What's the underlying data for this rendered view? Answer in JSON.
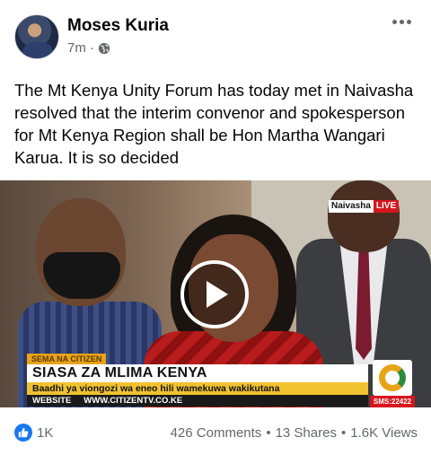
{
  "post": {
    "author": "Moses Kuria",
    "time": "7m",
    "separator": "·",
    "text": "The Mt Kenya Unity Forum has today met in Naivasha resolved that the interim convenor and spokesperson for Mt Kenya Region shall be Hon Martha Wangari Karua. It is so decided"
  },
  "video": {
    "live_place": "Naivasha",
    "live_word": "LIVE",
    "segment": "SEMA NA CITIZEN",
    "headline": "SIASA ZA MLIMA KENYA",
    "subline": "Baadhi ya viongozi wa eneo hili wamekuwa wakikutana",
    "web_label": "WEBSITE",
    "web_url": "WWW.CITIZENTV.CO.KE",
    "sms": "SMS:22422"
  },
  "footer": {
    "likes": "1K",
    "comments": "426 Comments",
    "shares": "13 Shares",
    "views": "1.6K Views",
    "dot": "•"
  },
  "colors": {
    "accent": "#1877f2",
    "live_red": "#d6161e",
    "ticker_yellow": "#f0c230"
  }
}
